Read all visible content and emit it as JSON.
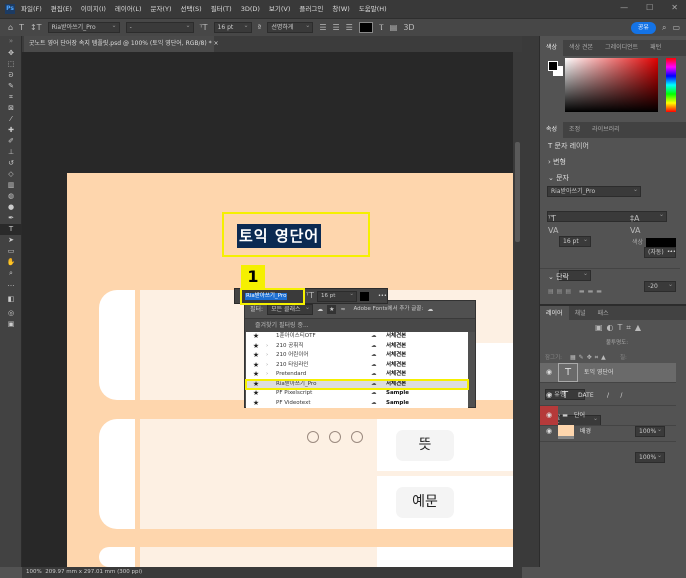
{
  "app": {
    "logo": "Ps"
  },
  "menu": [
    "파일(F)",
    "편집(E)",
    "이미지(I)",
    "레이어(L)",
    "문자(Y)",
    "선택(S)",
    "필터(T)",
    "3D(D)",
    "보기(V)",
    "플러그인",
    "창(W)",
    "도움말(H)"
  ],
  "window_controls": [
    "—",
    "☐",
    "✕"
  ],
  "options": {
    "font": "Ria받아쓰기_Pro",
    "style": "-",
    "size": "16 pt",
    "aa": "선명하게",
    "share": "공유"
  },
  "document": {
    "tab": "굿노트 영어 단어장 속지 템플릿.psd @ 100% (토익 영단어, RGB/8) *",
    "close": "×"
  },
  "canvas": {
    "title_text": "토익 영단어",
    "badge": "1",
    "btn_meaning": "뜻",
    "btn_example": "예문"
  },
  "mini_toolbar": {
    "font": "Ria받아쓰기_Pro",
    "size": "16 pt",
    "more": "•••"
  },
  "font_panel": {
    "filter_label": "필터:",
    "filter_value": "모든 클래스",
    "adobe_fonts": "Adobe Fonts에서 추가 글꼴:",
    "fav_note": "즐겨찾기 필터링 중...",
    "fonts": [
      {
        "name": "1훈아이스티OTF",
        "sample": "서체견본",
        "expand": false,
        "selected": false
      },
      {
        "name": "210 공휘직",
        "sample": "서체견본",
        "expand": true,
        "selected": false
      },
      {
        "name": "210 어린이어",
        "sample": "서체견본",
        "expand": true,
        "selected": false
      },
      {
        "name": "210 타임라인",
        "sample": "서체견본",
        "expand": true,
        "selected": false
      },
      {
        "name": "Pretendard",
        "sample": "서체견본",
        "expand": true,
        "selected": false
      },
      {
        "name": "Ria받아쓰기_Pro",
        "sample": "서체견본",
        "expand": false,
        "selected": true
      },
      {
        "name": "PF Pixelscript",
        "sample": "Sample",
        "expand": false,
        "selected": false
      },
      {
        "name": "PF Videotext",
        "sample": "Sample",
        "expand": false,
        "selected": false
      }
    ]
  },
  "color_panel": {
    "tabs": [
      "색상",
      "색상 견본",
      "그레이디언트",
      "패턴"
    ]
  },
  "properties": {
    "tabs": [
      "속성",
      "조정",
      "라이브러리"
    ],
    "layer_type": "문자 레이어",
    "transform": "변형",
    "char_section": "문자",
    "font": "Ria받아쓰기_Pro",
    "style": "-",
    "size": "16 pt",
    "leading": "(자동)",
    "kerning": "",
    "tracking": "-20",
    "color_label": "색상",
    "para_section": "단락",
    "more": "•••"
  },
  "layers": {
    "tabs": [
      "레이어",
      "채널",
      "패스"
    ],
    "search": "유형",
    "blend": "표준",
    "opacity_label": "불투명도:",
    "opacity": "100%",
    "lock_label": "잠그기:",
    "fill_label": "칠:",
    "fill": "100%",
    "items": [
      {
        "name": "토익 영단어",
        "type": "text",
        "selected": true
      },
      {
        "name": "DATE       /      /",
        "type": "text",
        "selected": false
      },
      {
        "name": "단어",
        "type": "group",
        "selected": false
      },
      {
        "name": "배경",
        "type": "image",
        "selected": false
      }
    ]
  },
  "status": {
    "zoom": "100%",
    "size": "209.97 mm x 297.01 mm (300 ppi)"
  },
  "colors": {
    "accent": "#1473e6",
    "highlight": "#f5f000",
    "page": "#fed6ad"
  }
}
